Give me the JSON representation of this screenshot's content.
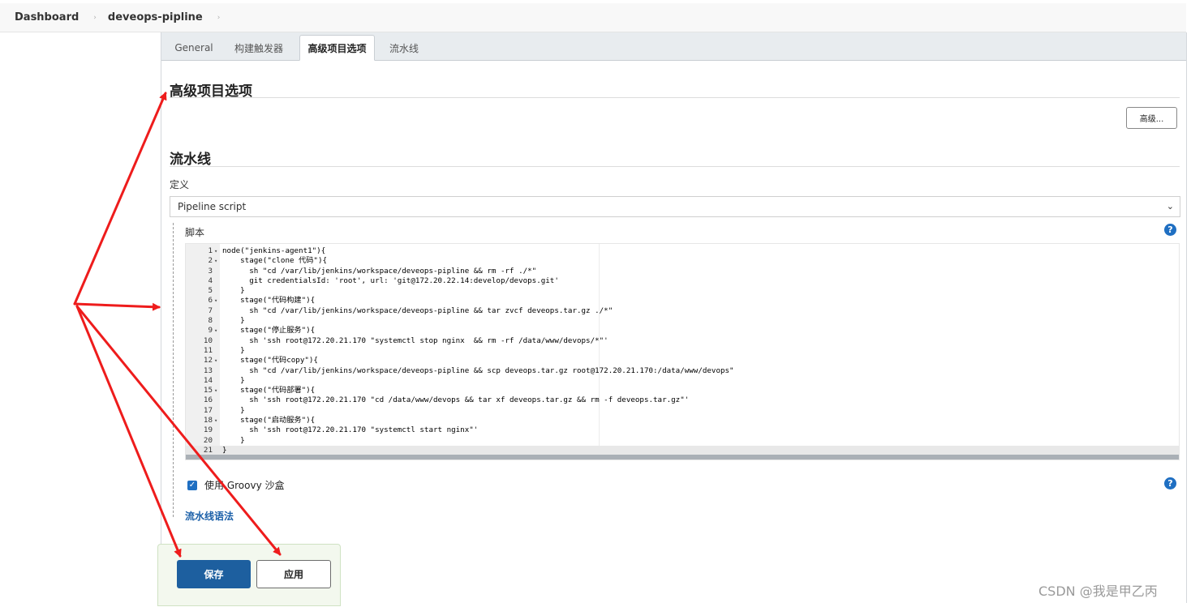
{
  "breadcrumb": {
    "items": [
      "Dashboard",
      "deveops-pipline"
    ],
    "separator": "›"
  },
  "tabs": [
    {
      "label": "General",
      "active": false
    },
    {
      "label": "构建触发器",
      "active": false
    },
    {
      "label": "高级项目选项",
      "active": true
    },
    {
      "label": "流水线",
      "active": false
    }
  ],
  "advanced_section": {
    "title": "高级项目选项",
    "advanced_button": "高级..."
  },
  "pipeline_section": {
    "title": "流水线",
    "definition_label": "定义",
    "definition_value": "Pipeline script",
    "script_label": "脚本",
    "help_icon": "?"
  },
  "script_lines": [
    {
      "n": "1",
      "fold": true,
      "text": "node(\"jenkins-agent1\"){"
    },
    {
      "n": "2",
      "fold": true,
      "text": "    stage(\"clone 代码\"){"
    },
    {
      "n": "3",
      "fold": false,
      "text": "      sh \"cd /var/lib/jenkins/workspace/deveops-pipline && rm -rf ./*\""
    },
    {
      "n": "4",
      "fold": false,
      "text": "      git credentialsId: 'root', url: 'git@172.20.22.14:develop/devops.git'"
    },
    {
      "n": "5",
      "fold": false,
      "text": "    }"
    },
    {
      "n": "6",
      "fold": true,
      "text": "    stage(\"代码构建\"){"
    },
    {
      "n": "7",
      "fold": false,
      "text": "      sh \"cd /var/lib/jenkins/workspace/deveops-pipline && tar zvcf deveops.tar.gz ./*\""
    },
    {
      "n": "8",
      "fold": false,
      "text": "    }"
    },
    {
      "n": "9",
      "fold": true,
      "text": "    stage(\"停止服务\"){"
    },
    {
      "n": "10",
      "fold": false,
      "text": "      sh 'ssh root@172.20.21.170 \"systemctl stop nginx  && rm -rf /data/www/devops/*\"'"
    },
    {
      "n": "11",
      "fold": false,
      "text": "    }"
    },
    {
      "n": "12",
      "fold": true,
      "text": "    stage(\"代码copy\"){"
    },
    {
      "n": "13",
      "fold": false,
      "text": "      sh \"cd /var/lib/jenkins/workspace/deveops-pipline && scp deveops.tar.gz root@172.20.21.170:/data/www/devops\""
    },
    {
      "n": "14",
      "fold": false,
      "text": "    }"
    },
    {
      "n": "15",
      "fold": true,
      "text": "    stage(\"代码部署\"){"
    },
    {
      "n": "16",
      "fold": false,
      "text": "      sh 'ssh root@172.20.21.170 \"cd /data/www/devops && tar xf deveops.tar.gz && rm -f deveops.tar.gz\"'"
    },
    {
      "n": "17",
      "fold": false,
      "text": "    }"
    },
    {
      "n": "18",
      "fold": true,
      "text": "    stage(\"启动服务\"){"
    },
    {
      "n": "19",
      "fold": false,
      "text": "      sh 'ssh root@172.20.21.170 \"systemctl start nginx\"'"
    },
    {
      "n": "20",
      "fold": false,
      "text": "    }"
    },
    {
      "n": "21",
      "fold": false,
      "text": "}",
      "current": true
    }
  ],
  "sandbox": {
    "label": "使用 Groovy 沙盒",
    "checked": true
  },
  "syntax_link": "流水线语法",
  "buttons": {
    "save": "保存",
    "apply": "应用"
  },
  "watermark": "CSDN @我是甲乙丙",
  "colors": {
    "primary": "#1d5f9f",
    "link": "#1a5fa8",
    "annotation_arrow": "#ee1c1c",
    "help_icon": "#1f6fc2"
  }
}
